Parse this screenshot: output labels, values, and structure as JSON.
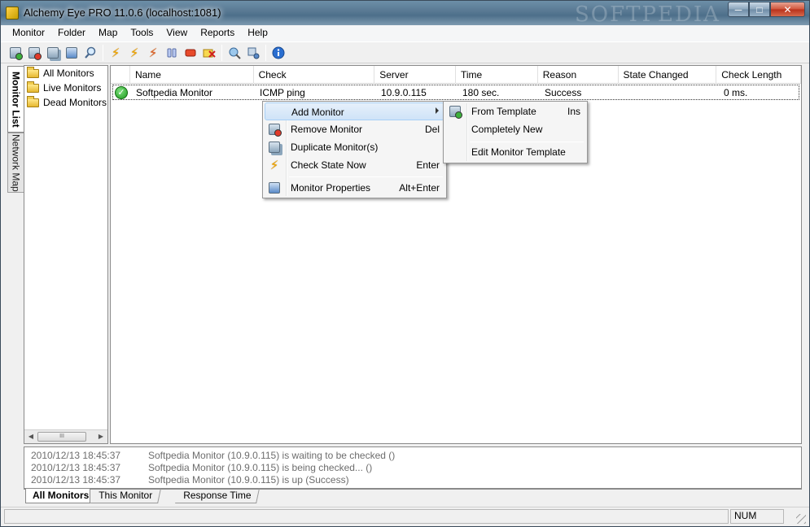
{
  "window": {
    "title": "Alchemy Eye PRO 11.0.6 (localhost:1081)",
    "watermark": "SOFTPEDIA",
    "buttons": {
      "minimize": "─",
      "maximize": "□",
      "close": "✕"
    }
  },
  "menubar": [
    "Monitor",
    "Folder",
    "Map",
    "Tools",
    "View",
    "Reports",
    "Help"
  ],
  "vertical_tabs": {
    "active": "Monitor List",
    "inactive": "Network Map"
  },
  "tree": {
    "items": [
      "All Monitors",
      "Live Monitors",
      "Dead Monitors"
    ],
    "scroll_thumb": "III"
  },
  "list": {
    "columns": [
      "Name",
      "Check",
      "Server",
      "Time",
      "Reason",
      "State Changed",
      "Check Length"
    ],
    "rows": [
      {
        "name": "Softpedia Monitor",
        "check": "ICMP ping",
        "server": "10.9.0.115",
        "time": "180 sec.",
        "reason": "Success",
        "state_changed": "",
        "check_length": "0 ms."
      }
    ]
  },
  "context_menu": {
    "items": [
      {
        "label": "Add Monitor",
        "shortcut": "",
        "icon": "add-monitor-icon",
        "submenu": true
      },
      {
        "label": "Remove Monitor",
        "shortcut": "Del",
        "icon": "remove-monitor-icon"
      },
      {
        "label": "Duplicate Monitor(s)",
        "shortcut": "",
        "icon": "duplicate-monitor-icon"
      },
      {
        "label": "Check State Now",
        "shortcut": "Enter",
        "icon": "lightning-icon"
      },
      {
        "label": "Monitor Properties",
        "shortcut": "Alt+Enter",
        "icon": "properties-icon"
      }
    ]
  },
  "submenu": {
    "items": [
      {
        "label": "From Template",
        "shortcut": "Ins"
      },
      {
        "label": "Completely New",
        "shortcut": ""
      },
      {
        "label": "Edit Monitor Template",
        "shortcut": ""
      }
    ]
  },
  "log": [
    {
      "time": "2010/12/13 18:45:37",
      "message": "Softpedia Monitor (10.9.0.115) is waiting to be checked ()"
    },
    {
      "time": "2010/12/13 18:45:37",
      "message": "Softpedia Monitor (10.9.0.115) is being checked... ()"
    },
    {
      "time": "2010/12/13 18:45:37",
      "message": "Softpedia Monitor (10.9.0.115) is up (Success)"
    }
  ],
  "bottom_tabs": [
    "All Monitors",
    "This Monitor",
    "Response Time"
  ],
  "statusbar": {
    "num": "NUM"
  },
  "colors": {
    "accent": "#cfe3f8",
    "status_ok": "#1c9a1c",
    "bolt": "#f0a800"
  }
}
